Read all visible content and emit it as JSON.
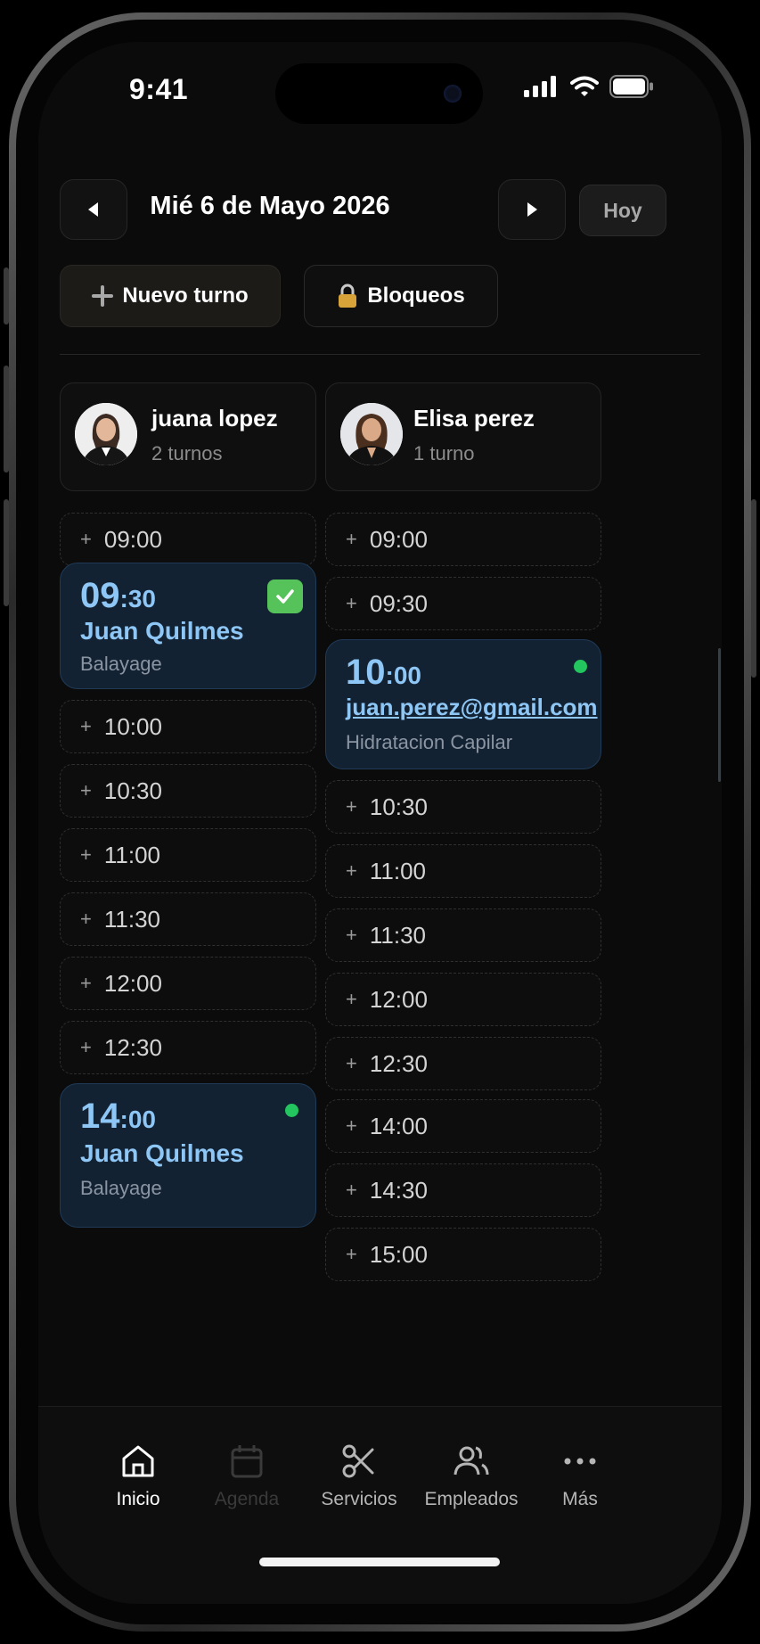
{
  "status_bar": {
    "time": "9:41"
  },
  "header": {
    "date": "Mié 6 de Mayo 2026",
    "today_label": "Hoy",
    "new_turn_label": "Nuevo turno",
    "blocks_label": "Bloqueos"
  },
  "columns": [
    {
      "name": "juana lopez",
      "count": "2 turnos",
      "slots": [
        "09:00",
        "10:00",
        "10:30",
        "11:00",
        "11:30",
        "12:00",
        "12:30"
      ],
      "appointments": [
        {
          "hour": "09",
          "minutes": ":30",
          "client": "Juan Quilmes",
          "service": "Balayage",
          "status": "confirmed"
        },
        {
          "hour": "14",
          "minutes": ":00",
          "client": "Juan Quilmes",
          "service": "Balayage",
          "status": "active"
        }
      ]
    },
    {
      "name": "Elisa perez",
      "count": "1 turno",
      "slots": [
        "09:00",
        "09:30",
        "10:30",
        "11:00",
        "11:30",
        "12:00",
        "12:30",
        "14:00",
        "14:30",
        "15:00"
      ],
      "appointments": [
        {
          "hour": "10",
          "minutes": ":00",
          "client": "juan.perez@gmail.com",
          "service": "Hidratacion Capilar",
          "status": "active"
        }
      ]
    }
  ],
  "tabbar": {
    "items": [
      {
        "label": "Inicio",
        "icon": "home-icon",
        "active": true
      },
      {
        "label": "Agenda",
        "icon": "calendar-icon",
        "active": false
      },
      {
        "label": "Servicios",
        "icon": "scissors-icon",
        "active": false
      },
      {
        "label": "Empleados",
        "icon": "users-icon",
        "active": false
      },
      {
        "label": "Más",
        "icon": "more-icon",
        "active": false
      }
    ]
  },
  "colors": {
    "background": "#0b0b0b",
    "appointment_bg": "#132233",
    "appointment_text": "#8ec7f5",
    "status_green": "#22c55e",
    "check_green": "#56c25a"
  }
}
